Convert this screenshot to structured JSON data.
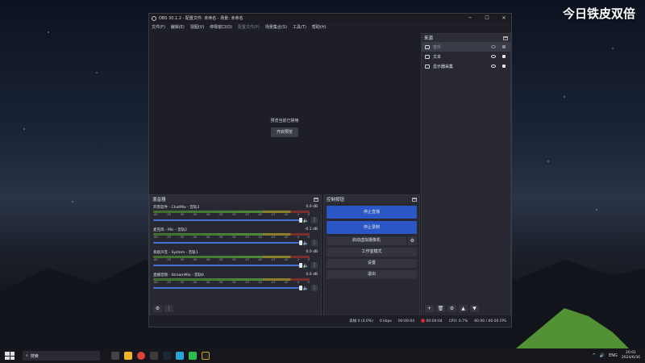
{
  "overlay_text": "今日铁皮双倍",
  "window": {
    "title": "OBS 30.1.2 - 配置文件: 未命名 - 场景: 未命名",
    "controls": [
      "─",
      "☐",
      "✕"
    ]
  },
  "menu": [
    {
      "label": "文件(F)",
      "dim": false
    },
    {
      "label": "编辑(E)",
      "dim": false
    },
    {
      "label": "视图(V)",
      "dim": false
    },
    {
      "label": "停靠窗口(D)",
      "dim": false
    },
    {
      "label": "配置文件(P)",
      "dim": true
    },
    {
      "label": "场景集合(S)",
      "dim": false
    },
    {
      "label": "工具(T)",
      "dim": false
    },
    {
      "label": "帮助(H)",
      "dim": false
    }
  ],
  "preview": {
    "message": "预览当前已禁用",
    "enable_button": "开启预览"
  },
  "sources": {
    "title": "来源",
    "items": [
      {
        "label": "音乐",
        "selected": true,
        "visible": false,
        "locked": false
      },
      {
        "label": "文本",
        "selected": false,
        "visible": true,
        "locked": true
      },
      {
        "label": "显示器采集",
        "selected": false,
        "visible": true,
        "locked": true
      }
    ],
    "toolbar": [
      "+",
      "🗑",
      "⚙",
      "▲",
      "▼"
    ]
  },
  "mixer": {
    "title": "混音器",
    "ticks": [
      "-60",
      "-55",
      "-50",
      "-45",
      "-40",
      "-35",
      "-30",
      "-25",
      "-20",
      "-15",
      "-10",
      "-5",
      "0"
    ],
    "channels": [
      {
        "name": "开黑软件 - ChatMix - 音轨3",
        "db": "0.0 dB"
      },
      {
        "name": "麦克风 - Mic - 音轨2",
        "db": "-0.1 dB"
      },
      {
        "name": "系统声音 - System - 音轨1",
        "db": "0.0 dB"
      },
      {
        "name": "直播音频 - StreamMix - 音轨6",
        "db": "0.0 dB"
      }
    ]
  },
  "controls": {
    "title": "控制按钮",
    "stop_stream": "停止直播",
    "stop_record": "停止录制",
    "virtual_cam": "启动虚拟摄像机",
    "studio_mode": "工作室模式",
    "settings": "设置",
    "exit": "退出"
  },
  "status": {
    "dropped": "丢帧 0 (0.0%)",
    "bitrate": "0 kbps",
    "stream_time": "00:00:04",
    "rec_time": "00:00:04",
    "cpu": "CPU: 0.7%",
    "fps": "60.00 / 60.00 FPS"
  },
  "taskbar": {
    "search_placeholder": "搜索",
    "lang": "ENG",
    "time": "20:01",
    "date": "2024/6/30"
  }
}
